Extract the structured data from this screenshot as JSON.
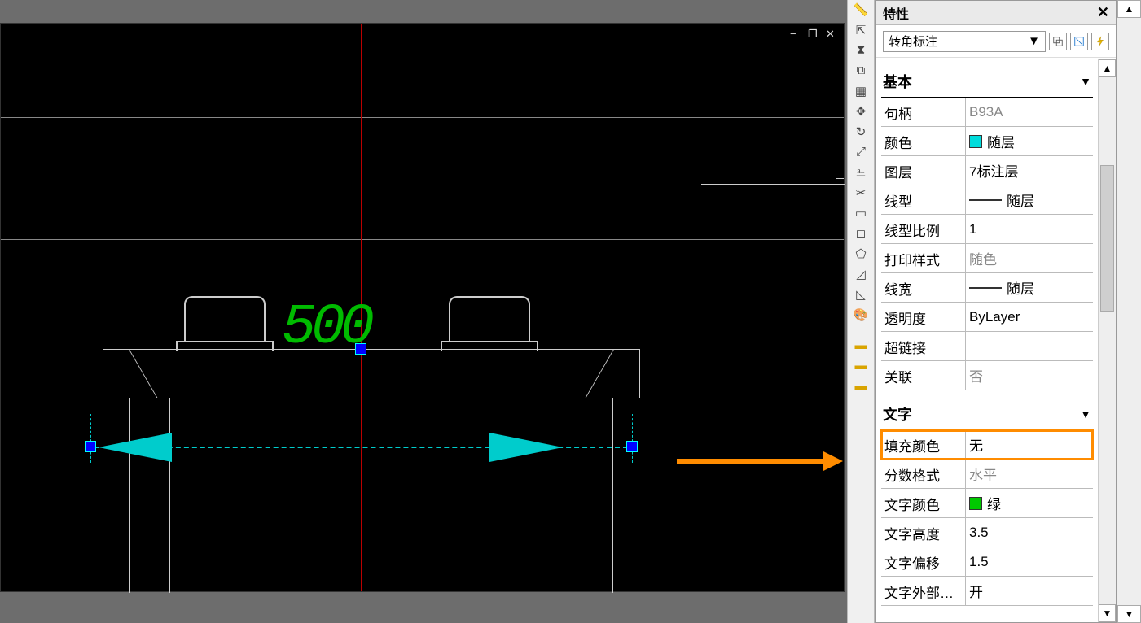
{
  "panel": {
    "title": "特性",
    "selector": "转角标注",
    "sections": [
      {
        "name": "基本",
        "rows": [
          {
            "k": "句柄",
            "v": "B93A",
            "disabled": true
          },
          {
            "k": "颜色",
            "v": "随层",
            "swatch": "#00dcdc"
          },
          {
            "k": "图层",
            "v": "7标注层"
          },
          {
            "k": "线型",
            "v": "随层",
            "lineimg": true
          },
          {
            "k": "线型比例",
            "v": "1"
          },
          {
            "k": "打印样式",
            "v": "随色",
            "disabled": true
          },
          {
            "k": "线宽",
            "v": "随层",
            "lineimg": true
          },
          {
            "k": "透明度",
            "v": "ByLayer"
          },
          {
            "k": "超链接",
            "v": ""
          },
          {
            "k": "关联",
            "v": "否",
            "disabled": true
          }
        ]
      },
      {
        "name": "文字",
        "rows": [
          {
            "k": "填充颜色",
            "v": "无",
            "highlight": true
          },
          {
            "k": "分数格式",
            "v": "水平",
            "disabled": true
          },
          {
            "k": "文字颜色",
            "v": "绿",
            "swatch": "#00c800"
          },
          {
            "k": "文字高度",
            "v": "3.5"
          },
          {
            "k": "文字偏移",
            "v": "1.5"
          },
          {
            "k": "文字外部对...",
            "v": "开"
          }
        ]
      }
    ]
  },
  "drawing": {
    "dim_text": "500"
  },
  "winctrl": {
    "min": "−",
    "restore": "❐",
    "close": "✕"
  }
}
